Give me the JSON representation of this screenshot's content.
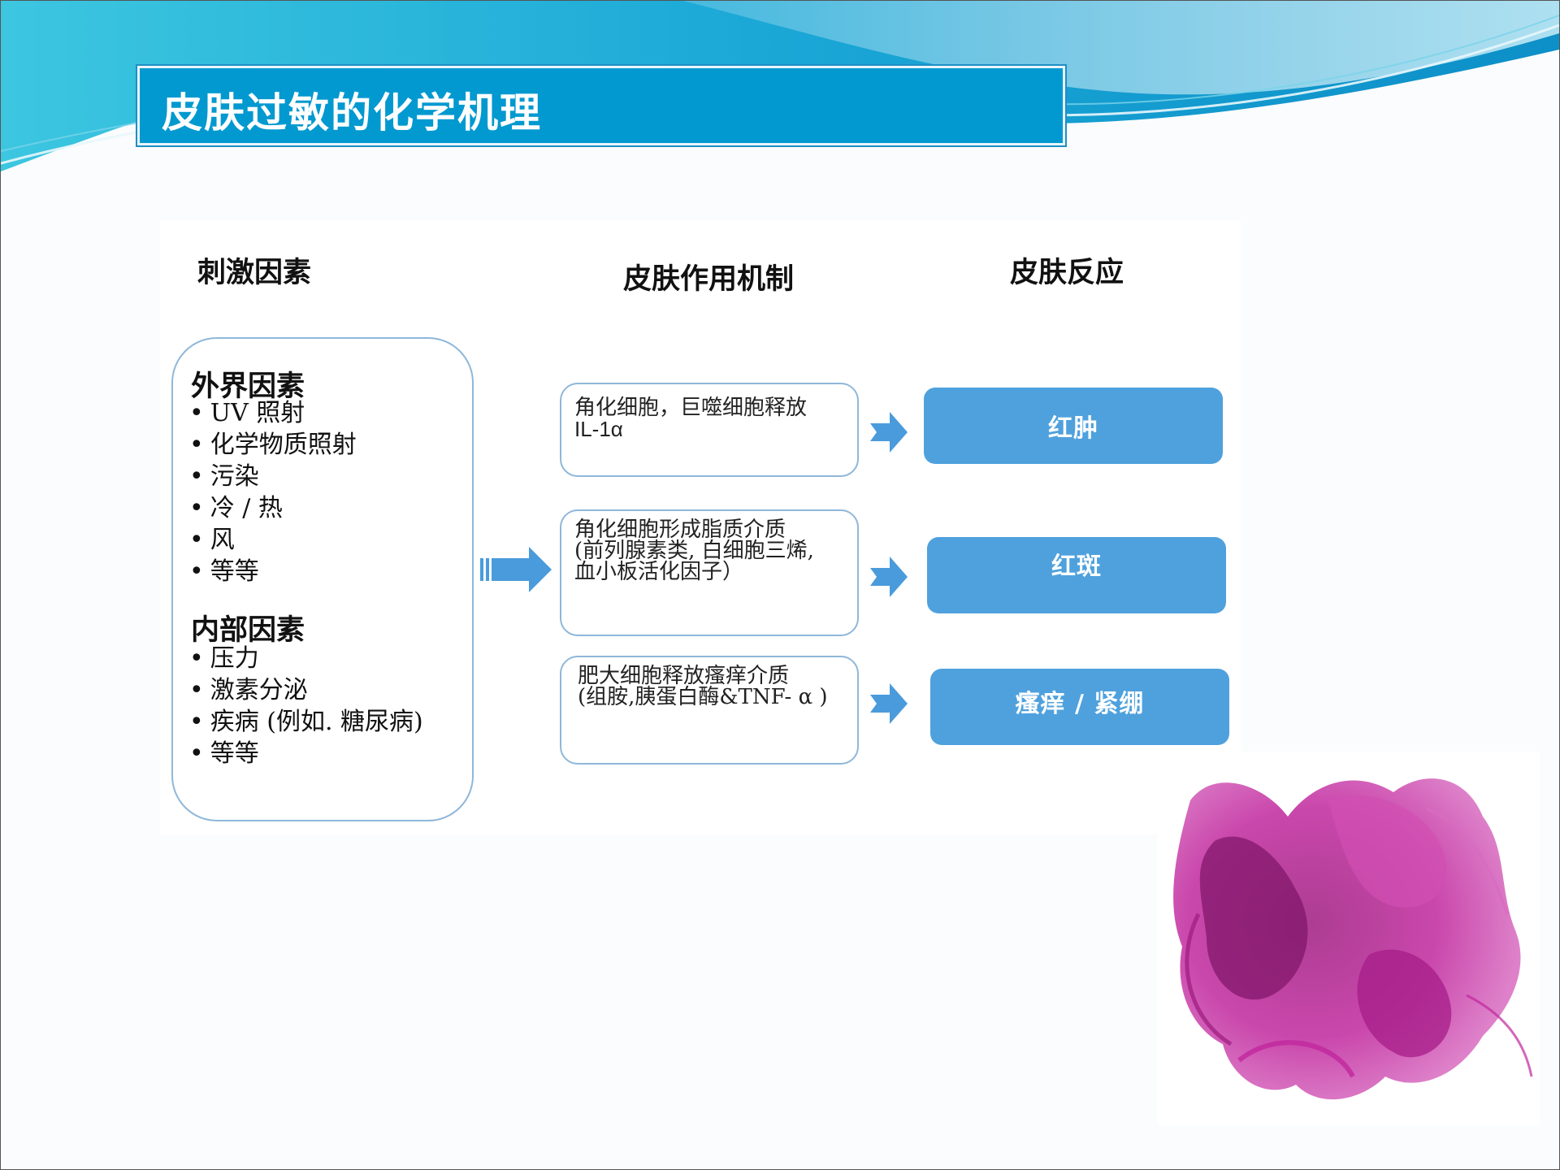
{
  "title": "皮肤过敏的化学机理",
  "columns": {
    "factors": "刺激因素",
    "mechanism": "皮肤作用机制",
    "reaction": "皮肤反应"
  },
  "external": {
    "title": "外界因素",
    "items": [
      "UV 照射",
      "化学物质照射",
      "污染",
      "冷 / 热",
      "风",
      "等等"
    ]
  },
  "internal": {
    "title": "内部因素",
    "items": [
      "压力",
      "激素分泌",
      "疾病 (例如. 糖尿病)",
      "等等"
    ]
  },
  "mechanisms": [
    {
      "lines": [
        "角化细胞，巨噬细胞释放",
        "IL-1α"
      ]
    },
    {
      "lines": [
        "角化细胞形成脂质介质",
        "(前列腺素类, 白细胞三烯,",
        "血小板活化因子）"
      ]
    },
    {
      "lines": [
        "肥大细胞释放瘙痒介质",
        "(组胺,胰蛋白酶&TNF- α )"
      ]
    }
  ],
  "reactions": [
    "红肿",
    "红斑",
    "瘙痒 /  紧绷"
  ],
  "colors": {
    "title_bg": "#0299d0",
    "reaction_bg": "#4fa1dd",
    "arrow": "#4a9bdc",
    "ink": "#c0279d"
  }
}
